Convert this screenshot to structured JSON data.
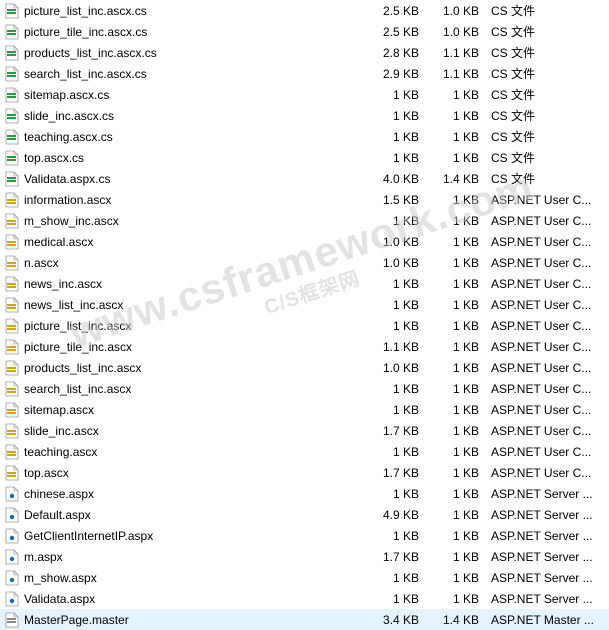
{
  "watermark": {
    "main": "www.csframework.com",
    "sub": "C/S框架网"
  },
  "icon_types": {
    "cs": {
      "fill": "#fff",
      "accent": "#2b9a3e",
      "corner": true
    },
    "ascx": {
      "fill": "#fff",
      "accent": "#d9a400",
      "corner": true,
      "bar": true
    },
    "aspx": {
      "fill": "#fff",
      "accent": "#0f6cbd",
      "corner": true,
      "dot": true
    },
    "master": {
      "fill": "#fff",
      "accent": "#888888",
      "corner": true
    }
  },
  "files": [
    {
      "icon": "cs",
      "name": "picture_list_inc.ascx.cs",
      "size1": "2.5 KB",
      "size2": "1.0 KB",
      "type": "CS 文件"
    },
    {
      "icon": "cs",
      "name": "picture_tile_inc.ascx.cs",
      "size1": "2.5 KB",
      "size2": "1.0 KB",
      "type": "CS 文件"
    },
    {
      "icon": "cs",
      "name": "products_list_inc.ascx.cs",
      "size1": "2.8 KB",
      "size2": "1.1 KB",
      "type": "CS 文件"
    },
    {
      "icon": "cs",
      "name": "search_list_inc.ascx.cs",
      "size1": "2.9 KB",
      "size2": "1.1 KB",
      "type": "CS 文件"
    },
    {
      "icon": "cs",
      "name": "sitemap.ascx.cs",
      "size1": "1 KB",
      "size2": "1 KB",
      "type": "CS 文件"
    },
    {
      "icon": "cs",
      "name": "slide_inc.ascx.cs",
      "size1": "1 KB",
      "size2": "1 KB",
      "type": "CS 文件"
    },
    {
      "icon": "cs",
      "name": "teaching.ascx.cs",
      "size1": "1 KB",
      "size2": "1 KB",
      "type": "CS 文件"
    },
    {
      "icon": "cs",
      "name": "top.ascx.cs",
      "size1": "1 KB",
      "size2": "1 KB",
      "type": "CS 文件"
    },
    {
      "icon": "cs",
      "name": "Validata.aspx.cs",
      "size1": "4.0 KB",
      "size2": "1.4 KB",
      "type": "CS 文件"
    },
    {
      "icon": "ascx",
      "name": "information.ascx",
      "size1": "1.5 KB",
      "size2": "1 KB",
      "type": "ASP.NET User C..."
    },
    {
      "icon": "ascx",
      "name": "m_show_inc.ascx",
      "size1": "1 KB",
      "size2": "1 KB",
      "type": "ASP.NET User C..."
    },
    {
      "icon": "ascx",
      "name": "medical.ascx",
      "size1": "1.0 KB",
      "size2": "1 KB",
      "type": "ASP.NET User C..."
    },
    {
      "icon": "ascx",
      "name": "n.ascx",
      "size1": "1.0 KB",
      "size2": "1 KB",
      "type": "ASP.NET User C..."
    },
    {
      "icon": "ascx",
      "name": "news_inc.ascx",
      "size1": "1 KB",
      "size2": "1 KB",
      "type": "ASP.NET User C..."
    },
    {
      "icon": "ascx",
      "name": "news_list_inc.ascx",
      "size1": "1 KB",
      "size2": "1 KB",
      "type": "ASP.NET User C..."
    },
    {
      "icon": "ascx",
      "name": "picture_list_inc.ascx",
      "size1": "1 KB",
      "size2": "1 KB",
      "type": "ASP.NET User C..."
    },
    {
      "icon": "ascx",
      "name": "picture_tile_inc.ascx",
      "size1": "1.1 KB",
      "size2": "1 KB",
      "type": "ASP.NET User C..."
    },
    {
      "icon": "ascx",
      "name": "products_list_inc.ascx",
      "size1": "1.0 KB",
      "size2": "1 KB",
      "type": "ASP.NET User C..."
    },
    {
      "icon": "ascx",
      "name": "search_list_inc.ascx",
      "size1": "1 KB",
      "size2": "1 KB",
      "type": "ASP.NET User C..."
    },
    {
      "icon": "ascx",
      "name": "sitemap.ascx",
      "size1": "1 KB",
      "size2": "1 KB",
      "type": "ASP.NET User C..."
    },
    {
      "icon": "ascx",
      "name": "slide_inc.ascx",
      "size1": "1.7 KB",
      "size2": "1 KB",
      "type": "ASP.NET User C..."
    },
    {
      "icon": "ascx",
      "name": "teaching.ascx",
      "size1": "1 KB",
      "size2": "1 KB",
      "type": "ASP.NET User C..."
    },
    {
      "icon": "ascx",
      "name": "top.ascx",
      "size1": "1.7 KB",
      "size2": "1 KB",
      "type": "ASP.NET User C..."
    },
    {
      "icon": "aspx",
      "name": "chinese.aspx",
      "size1": "1 KB",
      "size2": "1 KB",
      "type": "ASP.NET Server ..."
    },
    {
      "icon": "aspx",
      "name": "Default.aspx",
      "size1": "4.9 KB",
      "size2": "1 KB",
      "type": "ASP.NET Server ..."
    },
    {
      "icon": "aspx",
      "name": "GetClientInternetIP.aspx",
      "size1": "1 KB",
      "size2": "1 KB",
      "type": "ASP.NET Server ..."
    },
    {
      "icon": "aspx",
      "name": "m.aspx",
      "size1": "1.7 KB",
      "size2": "1 KB",
      "type": "ASP.NET Server ..."
    },
    {
      "icon": "aspx",
      "name": "m_show.aspx",
      "size1": "1 KB",
      "size2": "1 KB",
      "type": "ASP.NET Server ..."
    },
    {
      "icon": "aspx",
      "name": "Validata.aspx",
      "size1": "1 KB",
      "size2": "1 KB",
      "type": "ASP.NET Server ..."
    },
    {
      "icon": "master",
      "name": "MasterPage.master",
      "size1": "3.4 KB",
      "size2": "1.4 KB",
      "type": "ASP.NET Master ...",
      "selected": true
    }
  ]
}
